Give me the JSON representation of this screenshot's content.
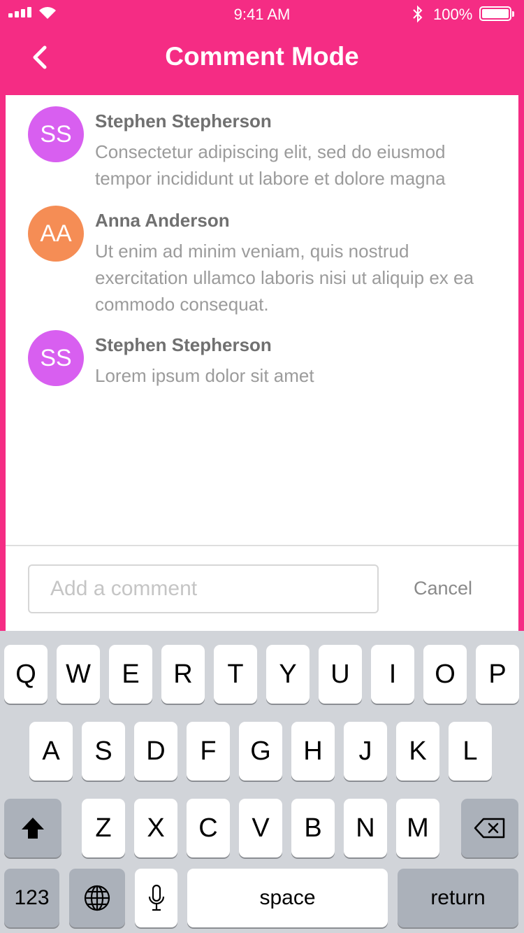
{
  "status_bar": {
    "time": "9:41 AM",
    "battery": "100%"
  },
  "header": {
    "title": "Comment Mode"
  },
  "comments": [
    {
      "initials": "SS",
      "avatar_color": "#d85ff0",
      "name": "Stephen Stepherson",
      "text": "Consectetur adipiscing elit, sed do eiusmod tempor incididunt ut labore et dolore magna"
    },
    {
      "initials": "AA",
      "avatar_color": "#f58d55",
      "name": "Anna Anderson",
      "text": "Ut enim ad minim veniam, quis nostrud exercitation ullamco laboris nisi ut aliquip ex ea commodo consequat."
    },
    {
      "initials": "SS",
      "avatar_color": "#d85ff0",
      "name": "Stephen Stepherson",
      "text": "Lorem ipsum dolor sit amet"
    }
  ],
  "composer": {
    "placeholder": "Add a comment",
    "cancel_label": "Cancel"
  },
  "keyboard": {
    "row1": [
      "Q",
      "W",
      "E",
      "R",
      "T",
      "Y",
      "U",
      "I",
      "O",
      "P"
    ],
    "row2": [
      "A",
      "S",
      "D",
      "F",
      "G",
      "H",
      "J",
      "K",
      "L"
    ],
    "row3": [
      "Z",
      "X",
      "C",
      "V",
      "B",
      "N",
      "M"
    ],
    "numbers_label": "123",
    "space_label": "space",
    "return_label": "return"
  },
  "colors": {
    "brand": "#f52c84"
  }
}
